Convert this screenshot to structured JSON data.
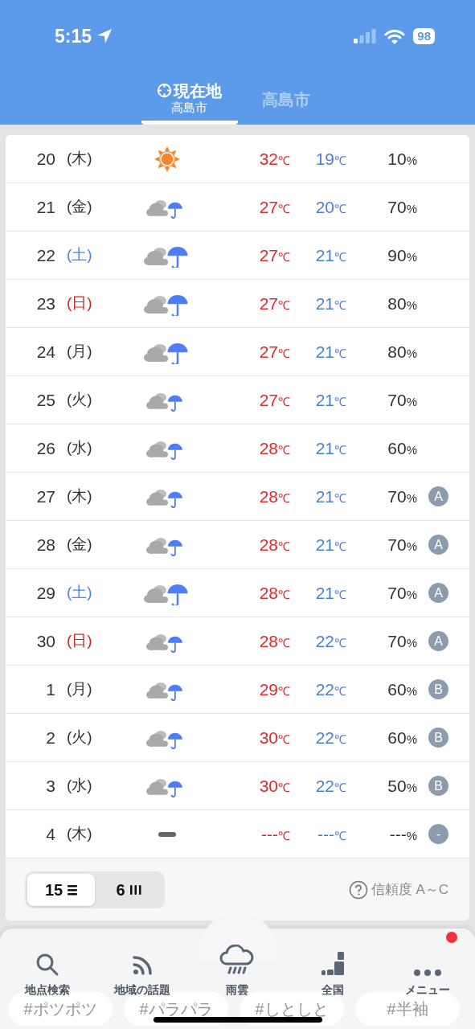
{
  "status_bar": {
    "time": "5:15",
    "battery": "98"
  },
  "tabs": [
    {
      "label": "現在地",
      "sublabel": "高島市",
      "selected": true
    },
    {
      "label": "高島市",
      "selected": false
    }
  ],
  "forecast": [
    {
      "day": "20",
      "weekday": "(木)",
      "color": "#333333",
      "weather": {
        "kind": "sunny"
      },
      "high": "32",
      "high_unit": "℃",
      "low": "19",
      "low_unit": "℃",
      "precip": "10",
      "precip_unit": "%"
    },
    {
      "day": "21",
      "weekday": "(金)",
      "color": "#333333",
      "weather": {
        "kind": "cloudy_rain"
      },
      "high": "27",
      "high_unit": "℃",
      "low": "20",
      "low_unit": "℃",
      "precip": "70",
      "precip_unit": "%"
    },
    {
      "day": "22",
      "weekday": "(土)",
      "color": "#4a86e8",
      "weather": {
        "kind": "cloudy_heavy_rain"
      },
      "high": "27",
      "high_unit": "℃",
      "low": "21",
      "low_unit": "℃",
      "precip": "90",
      "precip_unit": "%"
    },
    {
      "day": "23",
      "weekday": "(日)",
      "color": "#e02020",
      "weather": {
        "kind": "cloudy_heavy_rain"
      },
      "high": "27",
      "high_unit": "℃",
      "low": "21",
      "low_unit": "℃",
      "precip": "80",
      "precip_unit": "%"
    },
    {
      "day": "24",
      "weekday": "(月)",
      "color": "#333333",
      "weather": {
        "kind": "cloudy_heavy_rain"
      },
      "high": "27",
      "high_unit": "℃",
      "low": "21",
      "low_unit": "℃",
      "precip": "80",
      "precip_unit": "%"
    },
    {
      "day": "25",
      "weekday": "(火)",
      "color": "#333333",
      "weather": {
        "kind": "cloudy_rain"
      },
      "high": "27",
      "high_unit": "℃",
      "low": "21",
      "low_unit": "℃",
      "precip": "70",
      "precip_unit": "%"
    },
    {
      "day": "26",
      "weekday": "(水)",
      "color": "#333333",
      "weather": {
        "kind": "cloudy_rain"
      },
      "high": "28",
      "high_unit": "℃",
      "low": "21",
      "low_unit": "℃",
      "precip": "60",
      "precip_unit": "%"
    },
    {
      "day": "27",
      "weekday": "(木)",
      "color": "#333333",
      "weather": {
        "kind": "cloudy_rain"
      },
      "high": "28",
      "high_unit": "℃",
      "low": "21",
      "low_unit": "℃",
      "precip": "70",
      "precip_unit": "%",
      "reliability": "A"
    },
    {
      "day": "28",
      "weekday": "(金)",
      "color": "#333333",
      "weather": {
        "kind": "cloudy_rain"
      },
      "high": "28",
      "high_unit": "℃",
      "low": "21",
      "low_unit": "℃",
      "precip": "70",
      "precip_unit": "%",
      "reliability": "A"
    },
    {
      "day": "29",
      "weekday": "(土)",
      "color": "#4a86e8",
      "weather": {
        "kind": "cloudy_heavy_rain"
      },
      "high": "28",
      "high_unit": "℃",
      "low": "21",
      "low_unit": "℃",
      "precip": "70",
      "precip_unit": "%",
      "reliability": "A"
    },
    {
      "day": "30",
      "weekday": "(日)",
      "color": "#e02020",
      "weather": {
        "kind": "cloudy_rain"
      },
      "high": "28",
      "high_unit": "℃",
      "low": "22",
      "low_unit": "℃",
      "precip": "70",
      "precip_unit": "%",
      "reliability": "A"
    },
    {
      "day": "1",
      "weekday": "(月)",
      "color": "#333333",
      "weather": {
        "kind": "cloudy_rain"
      },
      "high": "29",
      "high_unit": "℃",
      "low": "22",
      "low_unit": "℃",
      "precip": "60",
      "precip_unit": "%",
      "reliability": "B"
    },
    {
      "day": "2",
      "weekday": "(火)",
      "color": "#333333",
      "weather": {
        "kind": "cloudy_rain"
      },
      "high": "30",
      "high_unit": "℃",
      "low": "22",
      "low_unit": "℃",
      "precip": "60",
      "precip_unit": "%",
      "reliability": "B"
    },
    {
      "day": "3",
      "weekday": "(水)",
      "color": "#333333",
      "weather": {
        "kind": "cloudy_rain"
      },
      "high": "30",
      "high_unit": "℃",
      "low": "22",
      "low_unit": "℃",
      "precip": "50",
      "precip_unit": "%",
      "reliability": "B"
    },
    {
      "day": "4",
      "weekday": "(木)",
      "color": "#333333",
      "weather": {
        "kind": "none"
      },
      "high": "---",
      "high_unit": "℃",
      "low": "---",
      "low_unit": "℃",
      "precip": "---",
      "precip_unit": "%",
      "reliability": "-"
    }
  ],
  "view_toggle": [
    {
      "label": "15",
      "kind": "list",
      "selected": true
    },
    {
      "label": "6",
      "kind": "columns",
      "selected": false
    }
  ],
  "reliability_help": "信頼度 A～C",
  "background_tags": [
    "#ポツポツ",
    "#パラパラ",
    "#しとしと",
    "#半袖"
  ],
  "bottom_nav": [
    {
      "label": "地点検索",
      "kind": "search"
    },
    {
      "label": "地域の話題",
      "kind": "rss"
    },
    {
      "label": "雨雲",
      "kind": "rain"
    },
    {
      "label": "全国",
      "kind": "japan"
    },
    {
      "label": "メニュー",
      "kind": "menu",
      "badge": true
    }
  ]
}
